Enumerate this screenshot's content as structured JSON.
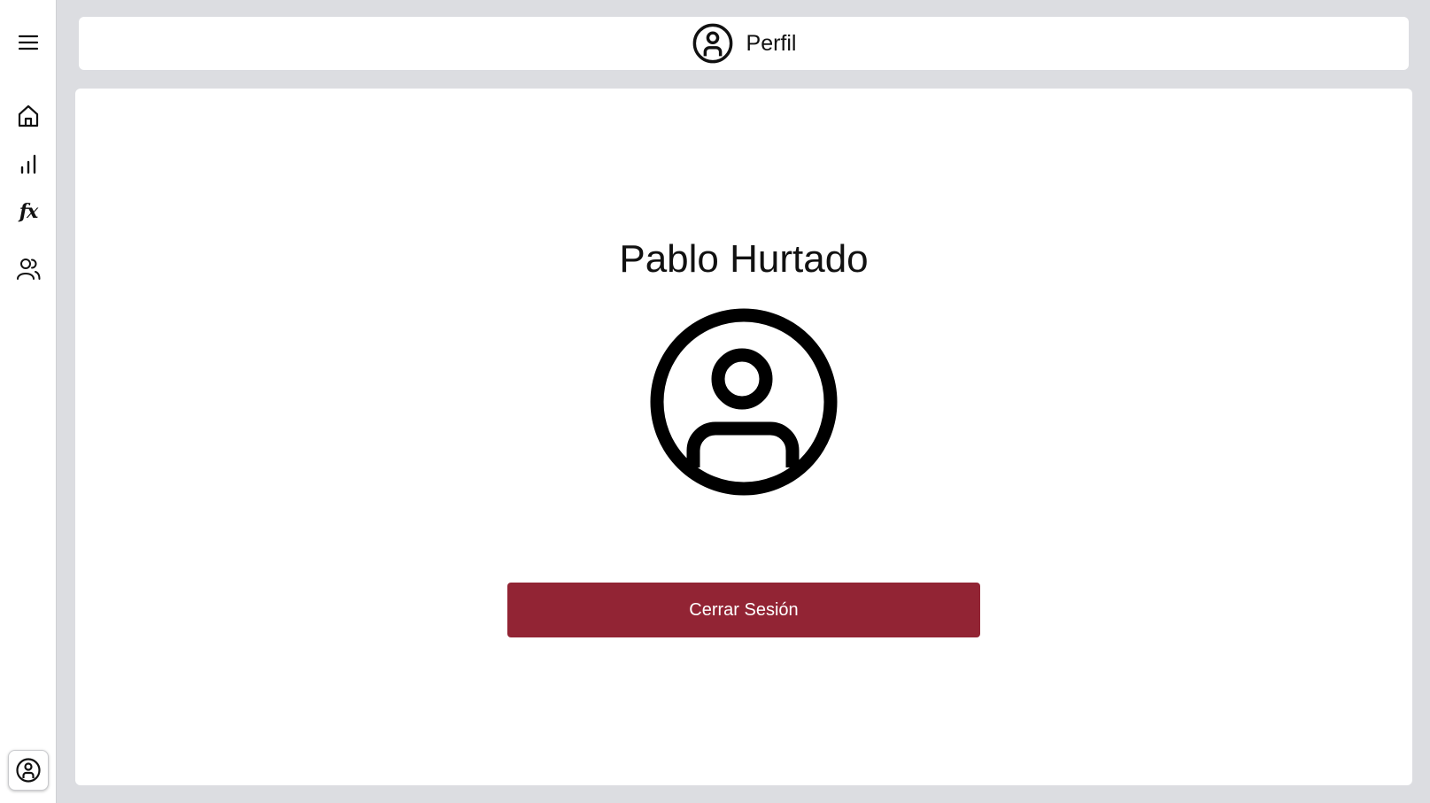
{
  "header": {
    "title": "Perfil",
    "icon": "user-circle-icon"
  },
  "sidebar": {
    "items": [
      {
        "name": "menu",
        "icon": "hamburger-menu-icon"
      },
      {
        "name": "home",
        "icon": "home-icon"
      },
      {
        "name": "stats",
        "icon": "bar-chart-icon"
      },
      {
        "name": "functions",
        "icon": "fx-icon",
        "glyph": "fx"
      },
      {
        "name": "users",
        "icon": "users-icon"
      }
    ],
    "profile": {
      "icon": "user-circle-icon"
    }
  },
  "profile": {
    "name": "Pablo Hurtado",
    "logout_label": "Cerrar Sesión"
  },
  "colors": {
    "background": "#dcdde1",
    "logout_button": "#922434",
    "panel": "#ffffff"
  }
}
